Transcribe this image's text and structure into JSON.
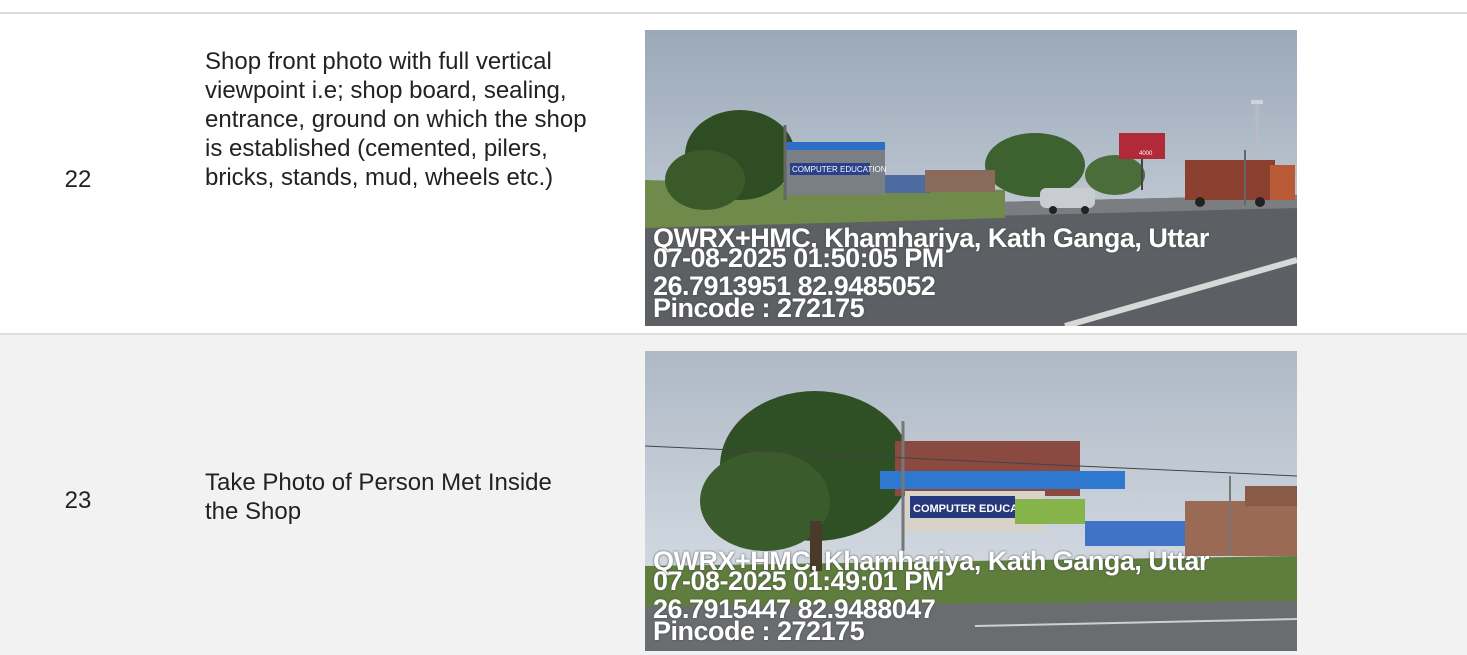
{
  "rows": [
    {
      "number": "22",
      "description": "Shop front photo with full vertical viewpoint i.e; shop board, sealing, entrance, ground on which the shop is established (cemented, pilers, bricks, stands, mud, wheels etc.)",
      "photo": {
        "address": "QWRX+HMC, Khamhariya, Kath Ganga, Uttar",
        "datetime": "07-08-2025 01:50:05 PM",
        "coordinates": "26.7913951 82.9485052",
        "pincode": "Pincode : 272175",
        "shop_sign": "COMPUTER EDUCATION",
        "billboard": "4000"
      }
    },
    {
      "number": "23",
      "description": "Take Photo of Person Met Inside the Shop",
      "photo": {
        "address": "QWRX+HMC, Khamhariya, Kath Ganga, Uttar",
        "datetime": "07-08-2025 01:49:01 PM",
        "coordinates": "26.7915447 82.9488047",
        "pincode": "Pincode : 272175",
        "shop_sign": "COMPUTER EDUCATION"
      }
    }
  ]
}
